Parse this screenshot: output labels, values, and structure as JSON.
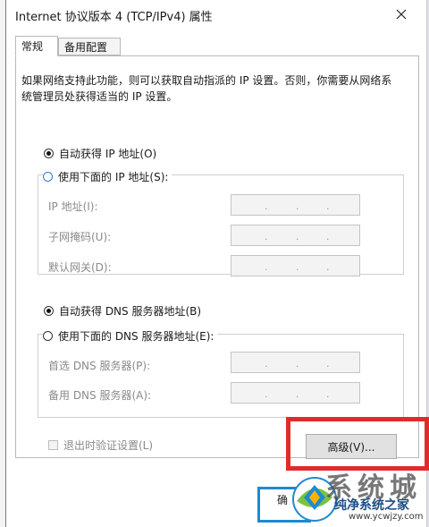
{
  "window": {
    "title": "Internet 协议版本 4 (TCP/IPv4) 属性",
    "close_icon": "close-icon"
  },
  "tabs": [
    {
      "label": "常规",
      "active": true
    },
    {
      "label": "备用配置",
      "active": false
    }
  ],
  "description": "如果网络支持此功能，则可以获取自动指派的 IP 设置。否则，你需要从网络系统管理员处获得适当的 IP 设置。",
  "ip_section": {
    "auto_option": "自动获得 IP 地址(O)",
    "manual_option": "使用下面的 IP 地址(S):",
    "selected": "auto",
    "fields": [
      {
        "label": "IP 地址(I):",
        "value": ". . ."
      },
      {
        "label": "子网掩码(U):",
        "value": ". . ."
      },
      {
        "label": "默认网关(D):",
        "value": ". . ."
      }
    ]
  },
  "dns_section": {
    "auto_option": "自动获得 DNS 服务器地址(B)",
    "manual_option": "使用下面的 DNS 服务器地址(E):",
    "selected": "auto",
    "fields": [
      {
        "label": "首选 DNS 服务器(P):",
        "value": ". . ."
      },
      {
        "label": "备用 DNS 服务器(A):",
        "value": ". . ."
      }
    ]
  },
  "validate_checkbox": {
    "label": "退出时验证设置(L)",
    "checked": false,
    "enabled": false
  },
  "advanced_button": "高级(V)...",
  "ok_button_partial": "确",
  "watermark": {
    "big_text": "系统城",
    "name": "纯净系统之家",
    "url": "www.ycwjzy.com"
  },
  "colors": {
    "highlight": "#e12b2b",
    "watermark_blue": "#1f8ad0",
    "radio_focus": "#2b7cd3"
  }
}
